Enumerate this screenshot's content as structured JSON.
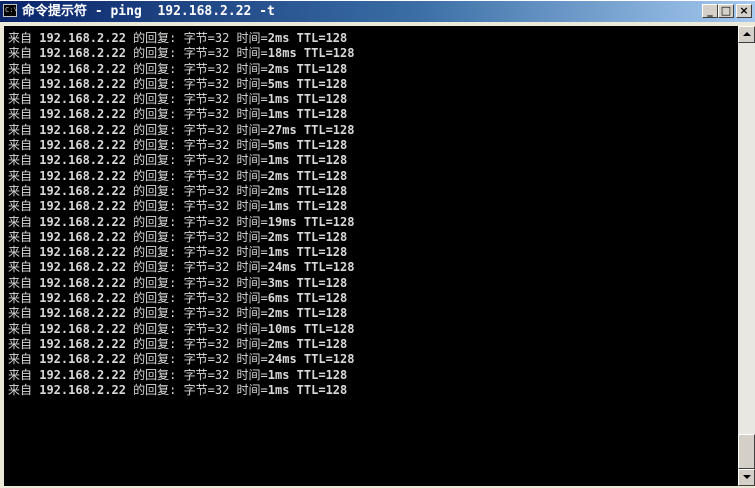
{
  "window": {
    "icon_text": "C:\\",
    "title": "命令提示符 - ping  192.168.2.22 -t",
    "controls": {
      "minimize": "_",
      "maximize": "□",
      "close": "×"
    }
  },
  "console": {
    "prefix": "来自 ",
    "host": "192.168.2.22",
    "reply": " 的回复: ",
    "bytes_label": "字节=32",
    "time_label": " 时间=",
    "ttl": " TTL=128",
    "times": [
      "2ms",
      "18ms",
      "2ms",
      "5ms",
      "1ms",
      "1ms",
      "27ms",
      "5ms",
      "1ms",
      "2ms",
      "2ms",
      "1ms",
      "19ms",
      "2ms",
      "1ms",
      "24ms",
      "3ms",
      "6ms",
      "2ms",
      "10ms",
      "2ms",
      "24ms",
      "1ms",
      "1ms"
    ]
  },
  "scrollbar": {
    "position": 1.0
  }
}
